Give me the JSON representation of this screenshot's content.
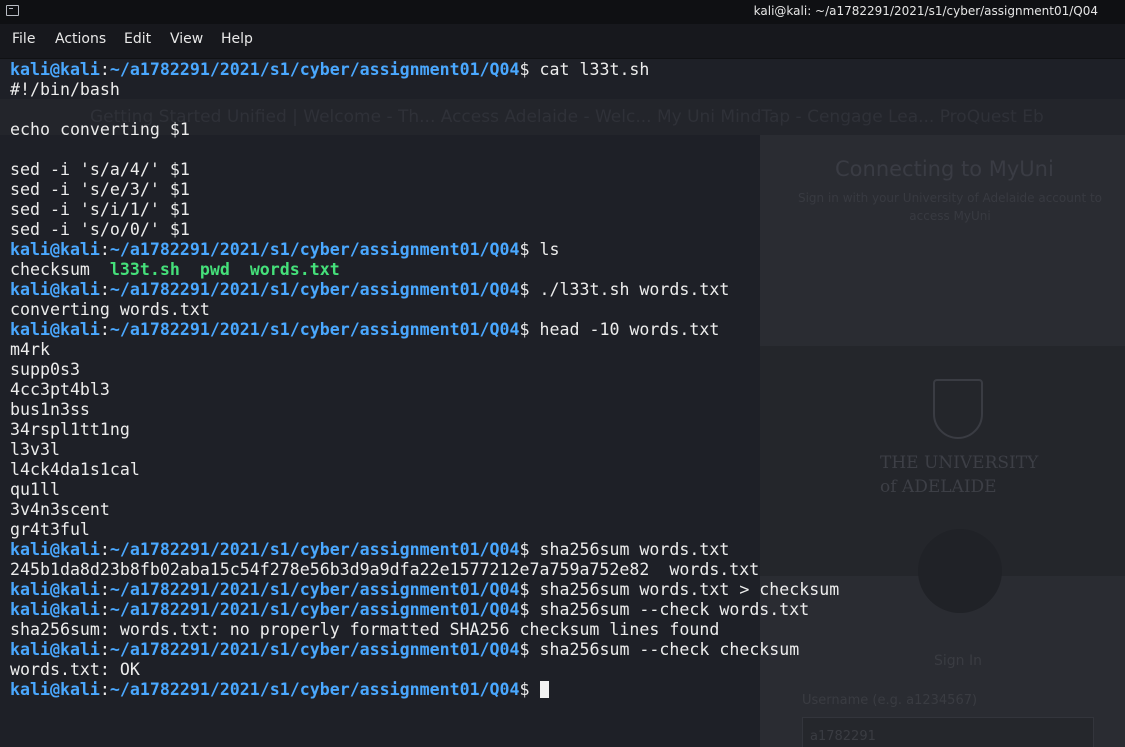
{
  "window": {
    "title": "kali@kali: ~/a1782291/2021/s1/cyber/assignment01/Q04"
  },
  "menu": [
    "File",
    "Actions",
    "Edit",
    "View",
    "Help"
  ],
  "prompt": {
    "user_host": "kali@kali",
    "path": "~/a1782291/2021/s1/cyber/assignment01/Q04",
    "symbol": "$"
  },
  "background": {
    "bookmarks": "Getting Started   Unified | Welcome - Th...   Access Adelaide - Welc...   My Uni   MindTap - Cengage Lea...   ProQuest Eb",
    "connecting": "Connecting to MyUni",
    "sub": "Sign in with your University of Adelaide account to access MyUni",
    "uni_line1": "THE UNIVERSITY",
    "uni_line2": "of ADELAIDE",
    "signin": "Sign In",
    "username_label": "Username (e.g. a1234567)",
    "username_value": "a1782291"
  },
  "terminal": {
    "lines": [
      {
        "t": "prompt",
        "cmd": " cat l33t.sh"
      },
      {
        "t": "out",
        "text": "#!/bin/bash"
      },
      {
        "t": "out",
        "text": ""
      },
      {
        "t": "out",
        "text": "echo converting $1"
      },
      {
        "t": "out",
        "text": ""
      },
      {
        "t": "out",
        "text": "sed -i 's/a/4/' $1"
      },
      {
        "t": "out",
        "text": "sed -i 's/e/3/' $1"
      },
      {
        "t": "out",
        "text": "sed -i 's/i/1/' $1"
      },
      {
        "t": "out",
        "text": "sed -i 's/o/0/' $1"
      },
      {
        "t": "prompt",
        "cmd": " ls"
      },
      {
        "t": "ls",
        "items": [
          {
            "name": "checksum",
            "green": false
          },
          {
            "name": "l33t.sh",
            "green": true
          },
          {
            "name": "pwd",
            "green": true
          },
          {
            "name": "words.txt",
            "green": true
          }
        ]
      },
      {
        "t": "prompt",
        "cmd": " ./l33t.sh words.txt"
      },
      {
        "t": "out",
        "text": "converting words.txt"
      },
      {
        "t": "prompt",
        "cmd": " head -10 words.txt"
      },
      {
        "t": "out",
        "text": "m4rk"
      },
      {
        "t": "out",
        "text": "supp0s3"
      },
      {
        "t": "out",
        "text": "4cc3pt4bl3"
      },
      {
        "t": "out",
        "text": "bus1n3ss"
      },
      {
        "t": "out",
        "text": "34rspl1tt1ng"
      },
      {
        "t": "out",
        "text": "l3v3l"
      },
      {
        "t": "out",
        "text": "l4ck4da1s1cal"
      },
      {
        "t": "out",
        "text": "qu1ll"
      },
      {
        "t": "out",
        "text": "3v4n3scent"
      },
      {
        "t": "out",
        "text": "gr4t3ful"
      },
      {
        "t": "prompt",
        "cmd": " sha256sum words.txt"
      },
      {
        "t": "out",
        "text": "245b1da8d23b8fb02aba15c54f278e56b3d9a9dfa22e1577212e7a759a752e82  words.txt"
      },
      {
        "t": "prompt",
        "cmd": " sha256sum words.txt > checksum"
      },
      {
        "t": "prompt",
        "cmd": " sha256sum --check words.txt"
      },
      {
        "t": "out",
        "text": "sha256sum: words.txt: no properly formatted SHA256 checksum lines found"
      },
      {
        "t": "prompt",
        "cmd": " sha256sum --check checksum"
      },
      {
        "t": "out",
        "text": "words.txt: OK"
      },
      {
        "t": "prompt",
        "cmd": " ",
        "cursor": true
      }
    ]
  },
  "colors": {
    "prompt": "#4aa8ff",
    "executable": "#45e07a",
    "text": "#ececec",
    "background": "#1e2027"
  }
}
